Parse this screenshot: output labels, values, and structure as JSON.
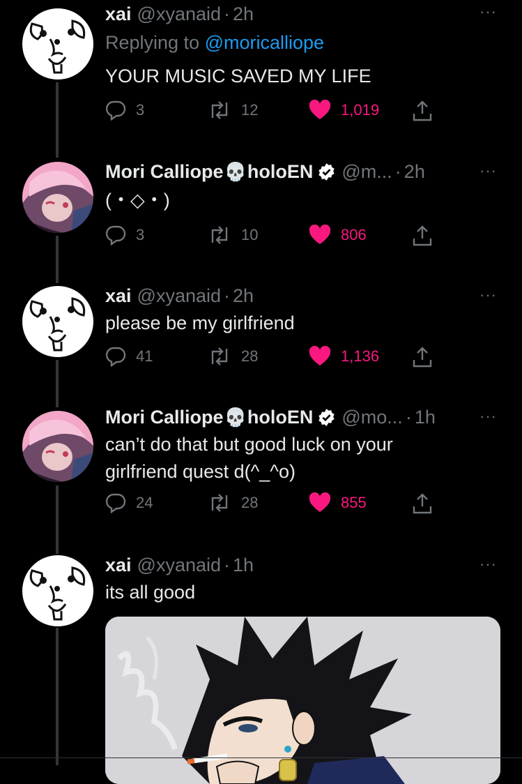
{
  "tweets": [
    {
      "name": "xai",
      "handle": "@xyanaid",
      "time": "2h",
      "replying_label": "Replying to",
      "replying_mention": "@moricalliope",
      "text": "YOUR MUSIC SAVED MY LIFE",
      "replies": "3",
      "retweets": "12",
      "likes": "1,019"
    },
    {
      "name": "Mori Calliope",
      "skull": "💀",
      "name_suffix": "holoEN",
      "handle": "@m...",
      "time": "2h",
      "text": "(・◇・)",
      "replies": "3",
      "retweets": "10",
      "likes": "806"
    },
    {
      "name": "xai",
      "handle": "@xyanaid",
      "time": "2h",
      "text": "please be my girlfriend",
      "replies": "41",
      "retweets": "28",
      "likes": "1,136"
    },
    {
      "name": "Mori Calliope",
      "skull": "💀",
      "name_suffix": "holoEN",
      "handle": "@mo...",
      "time": "1h",
      "text": "can’t do that but good luck on your\ngirlfriend quest d(^_^o)",
      "replies": "24",
      "retweets": "28",
      "likes": "855"
    },
    {
      "name": "xai",
      "handle": "@xyanaid",
      "time": "1h",
      "text": "its all good"
    }
  ],
  "separator": "·",
  "more_glyph": "···",
  "colors": {
    "background": "#000000",
    "text": "#e7e9ea",
    "muted": "#71767b",
    "link": "#1d9bf0",
    "like": "#f91880",
    "verified": "#ffffff"
  }
}
